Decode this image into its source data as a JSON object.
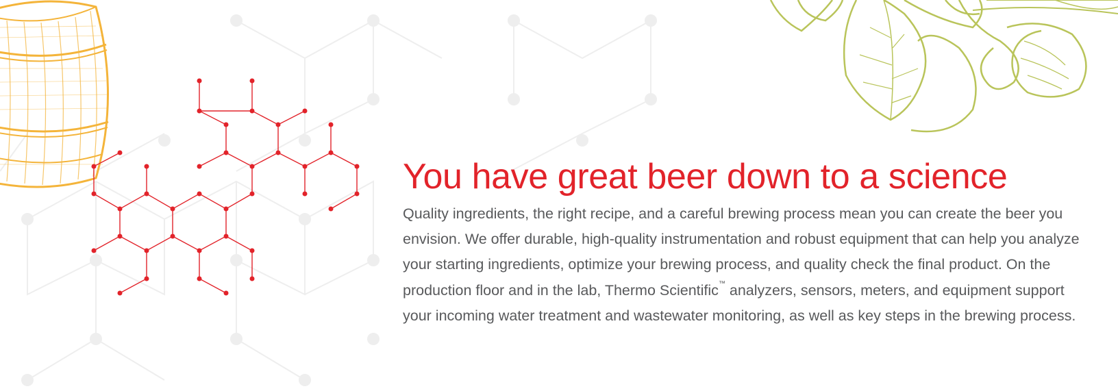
{
  "headline": "You have great beer down to a science",
  "body": {
    "part1": "Quality ingredients, the right recipe, and a careful brewing process mean you can create the beer you envision. We offer durable, high-quality instrumentation and robust equipment that can help you analyze your starting ingredients, optimize your brewing process, and quality check the final product. On the production floor and in the lab, Thermo Scientific",
    "trademark": "™",
    "part2": " analyzers, sensors, meters, and equipment support your incoming water treatment and wastewater monitoring, as well as key steps in the brewing process."
  },
  "colors": {
    "accent": "#e2232a",
    "text": "#58595b",
    "barrel": "#f4b43a",
    "hops": "#b9c45a",
    "network": "#ececec"
  },
  "icons": [
    "barrel-illustration",
    "hops-illustration",
    "molecule-network"
  ]
}
